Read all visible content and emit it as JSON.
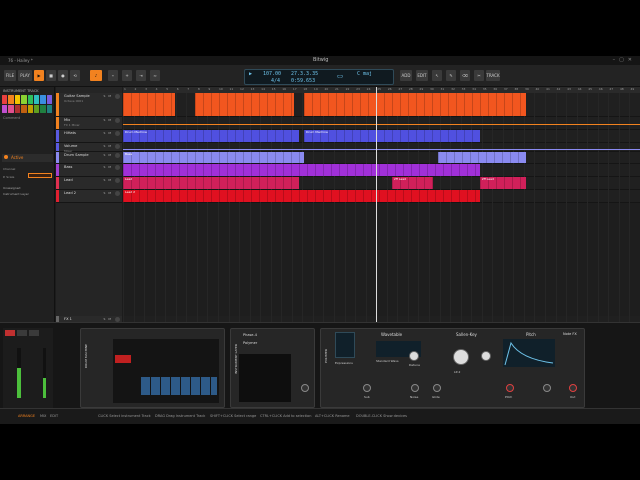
{
  "window": {
    "title": "76 - Hailey *",
    "logo": "Bitwig"
  },
  "toolbar": {
    "file": "FILE",
    "play": "PLAY",
    "add": "ADD",
    "edit": "EDIT",
    "track": "TRACK",
    "tempo": "107.00",
    "signature": "4/4",
    "position": "27.3.3.35",
    "time": "0:59.653",
    "key": "C maj"
  },
  "inspector": {
    "title": "INSTRUMENT TRACK",
    "notes": "Comment",
    "active_label": "Active",
    "channel": "Channel",
    "project_scale": "P. Scale",
    "routing": [
      "Unassigned",
      "Instrument Layer"
    ],
    "all_ins": "All ins",
    "master": "Master"
  },
  "palette": [
    "#e94040",
    "#f2821f",
    "#f5c400",
    "#8bd232",
    "#2fbf5c",
    "#2fbfbf",
    "#3a8fe0",
    "#7a5ce0",
    "#c050d0",
    "#e05090",
    "#b03030",
    "#c06010",
    "#c0a000",
    "#60a020",
    "#208040",
    "#208080"
  ],
  "tracks": [
    {
      "name": "Guitar Sample",
      "sub": "Octave 0001",
      "color": "#f2821f"
    },
    {
      "name": "Mix",
      "sub": "FX 1 Mixer",
      "color": "#f2821f"
    },
    {
      "name": "HiHats",
      "sub": "",
      "color": "#5a5ae0"
    },
    {
      "name": "Volume",
      "sub": "Mixer",
      "color": "#5a5ae0"
    },
    {
      "name": "Drum Sample",
      "sub": "",
      "color": "#8a8af0"
    },
    {
      "name": "Bass",
      "sub": "",
      "color": "#a040d0"
    },
    {
      "name": "Lead",
      "sub": "",
      "color": "#e03050"
    },
    {
      "name": "Lead 2",
      "sub": "",
      "color": "#e02030"
    },
    {
      "name": "FX 1",
      "sub": "",
      "color": "#666"
    },
    {
      "name": "Master",
      "sub": "",
      "color": "#666"
    }
  ],
  "ruler": [
    "1",
    "2",
    "3",
    "4",
    "5",
    "6",
    "7",
    "8",
    "9",
    "10",
    "11",
    "12",
    "13",
    "14",
    "15",
    "16",
    "17",
    "18",
    "19",
    "20",
    "21",
    "22",
    "23",
    "24",
    "25",
    "26",
    "27",
    "28",
    "29",
    "30",
    "31",
    "32",
    "33",
    "34",
    "35",
    "36",
    "37",
    "38",
    "39",
    "40",
    "41",
    "42",
    "43",
    "44",
    "45",
    "46",
    "47",
    "48",
    "49"
  ],
  "clips": [
    {
      "track": 0,
      "start": 0,
      "end": 0.1,
      "color": "#f2561f",
      "label": ""
    },
    {
      "track": 0,
      "start": 0.14,
      "end": 0.33,
      "color": "#f2561f",
      "label": ""
    },
    {
      "track": 0,
      "start": 0.35,
      "end": 0.78,
      "color": "#f2561f",
      "label": ""
    },
    {
      "track": 2,
      "start": 0,
      "end": 0.34,
      "color": "#5050e0",
      "label": "Drum Machine"
    },
    {
      "track": 2,
      "start": 0.35,
      "end": 0.69,
      "color": "#5050e0",
      "label": "Drum Machine"
    },
    {
      "track": 4,
      "start": 0,
      "end": 0.35,
      "color": "#8a8af0",
      "label": "Bass"
    },
    {
      "track": 4,
      "start": 0.61,
      "end": 0.78,
      "color": "#8a8af0",
      "label": ""
    },
    {
      "track": 5,
      "start": 0,
      "end": 0.69,
      "color": "#a030d8",
      "label": ""
    },
    {
      "track": 6,
      "start": 0,
      "end": 0.34,
      "color": "#d0205a",
      "label": "Lead"
    },
    {
      "track": 6,
      "start": 0.52,
      "end": 0.6,
      "color": "#d0205a",
      "label": "2ff Lead"
    },
    {
      "track": 6,
      "start": 0.69,
      "end": 0.78,
      "color": "#d0205a",
      "label": "2ff Lead"
    },
    {
      "track": 7,
      "start": 0,
      "end": 0.69,
      "color": "#e01020",
      "label": "Lead 2"
    }
  ],
  "devices": {
    "drum_machine": "DRUM MACHINE",
    "instrument_layer": "INSTRUMENT LAYER",
    "layer_items": [
      "Phase-4",
      "Polymer"
    ],
    "polymer": "POLYMER",
    "osc": "Wavetable",
    "filter": "Sallen-Key",
    "env": "Pitch",
    "note_fx": "Note FX",
    "labels": [
      "Expressions",
      "Standard Wavs",
      "Detune",
      "Sub",
      "Noise",
      "Glide",
      "LP-2",
      "Pitch",
      "Out"
    ]
  },
  "status": {
    "arrange": "ARRANGE",
    "mix": "MIX",
    "edit": "EDIT",
    "hints": [
      "CLICK Select instrument Track",
      "DRAG Drag Instrument Track",
      "SHIFT+CLICK Select range",
      "CTRL+CLICK Add to selection",
      "ALT+CLICK Rename",
      "DOUBLE-CLICK Show devices"
    ]
  }
}
